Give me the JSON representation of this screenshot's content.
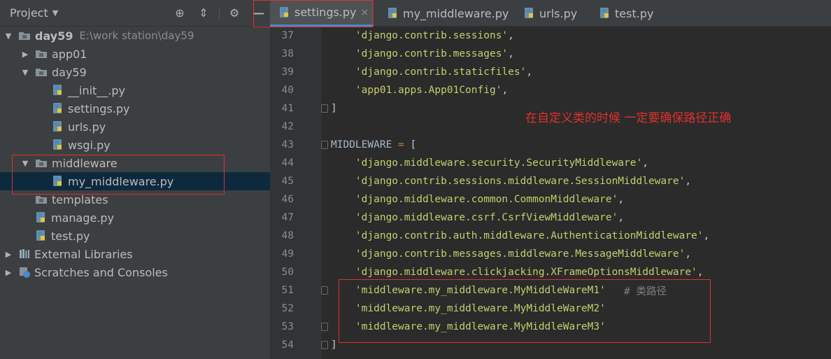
{
  "project_panel": {
    "title": "Project",
    "tree": [
      {
        "label": "day59",
        "hint": "E:\\work station\\day59",
        "type": "folder",
        "expanded": true
      },
      {
        "label": "app01",
        "type": "folder",
        "expanded": false
      },
      {
        "label": "day59",
        "type": "folder",
        "expanded": true
      },
      {
        "label": "__init__.py",
        "type": "py"
      },
      {
        "label": "settings.py",
        "type": "py"
      },
      {
        "label": "urls.py",
        "type": "py"
      },
      {
        "label": "wsgi.py",
        "type": "py"
      },
      {
        "label": "middleware",
        "type": "folder",
        "expanded": true
      },
      {
        "label": "my_middleware.py",
        "type": "py",
        "selected": true
      },
      {
        "label": "templates",
        "type": "folder"
      },
      {
        "label": "manage.py",
        "type": "py"
      },
      {
        "label": "test.py",
        "type": "py"
      },
      {
        "label": "External Libraries",
        "type": "lib"
      },
      {
        "label": "Scratches and Consoles",
        "type": "scratch"
      }
    ]
  },
  "tabs": [
    {
      "label": "settings.py",
      "active": true
    },
    {
      "label": "my_middleware.py"
    },
    {
      "label": "urls.py"
    },
    {
      "label": "test.py"
    }
  ],
  "editor": {
    "lines": [
      {
        "num": "37",
        "code": "    'django.contrib.sessions',"
      },
      {
        "num": "38",
        "code": "    'django.contrib.messages',"
      },
      {
        "num": "39",
        "code": "    'django.contrib.staticfiles',"
      },
      {
        "num": "40",
        "code": "    'app01.apps.App01Config',"
      },
      {
        "num": "41",
        "code": "]"
      },
      {
        "num": "42",
        "code": ""
      },
      {
        "num": "43",
        "code": "MIDDLEWARE = ["
      },
      {
        "num": "44",
        "code": "    'django.middleware.security.SecurityMiddleware',"
      },
      {
        "num": "45",
        "code": "    'django.contrib.sessions.middleware.SessionMiddleware',"
      },
      {
        "num": "46",
        "code": "    'django.middleware.common.CommonMiddleware',"
      },
      {
        "num": "47",
        "code": "    'django.middleware.csrf.CsrfViewMiddleware',"
      },
      {
        "num": "48",
        "code": "    'django.contrib.auth.middleware.AuthenticationMiddleware',"
      },
      {
        "num": "49",
        "code": "    'django.contrib.messages.middleware.MessageMiddleware',"
      },
      {
        "num": "50",
        "code": "    'django.middleware.clickjacking.XFrameOptionsMiddleware',"
      },
      {
        "num": "51",
        "code": "    'middleware.my_middleware.MyMiddleWareM1'",
        "comment": "# 类路径"
      },
      {
        "num": "52",
        "code": "    'middleware.my_middleware.MyMiddleWareM2'"
      },
      {
        "num": "53",
        "code": "    'middleware.my_middleware.MyMiddleWareM3'"
      },
      {
        "num": "54",
        "code": "]"
      }
    ],
    "annotation": "在自定义类的时候 一定要确保路径正确"
  },
  "colors": {
    "string": "#c6cd6d",
    "annotation_red": "#e0302c",
    "selection": "#0d293e"
  }
}
